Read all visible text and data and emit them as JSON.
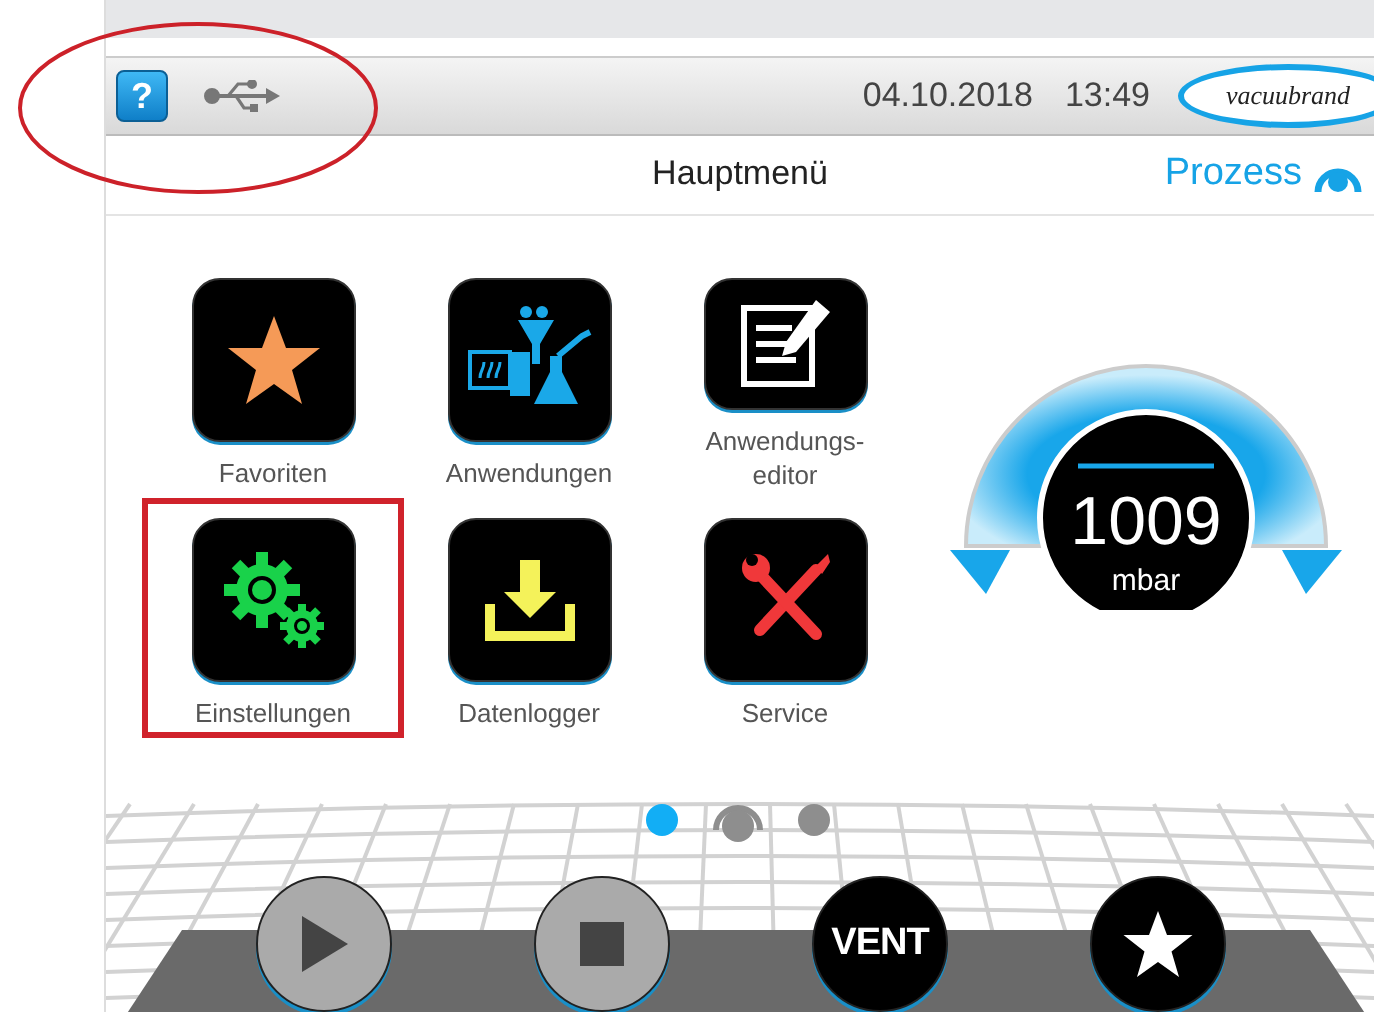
{
  "status_bar": {
    "help_button": "?",
    "date": "04.10.2018",
    "time": "13:49",
    "logo": "vacuubrand",
    "circled": true
  },
  "header": {
    "title": "Hauptmenü",
    "process_link": "Prozess"
  },
  "menu": [
    {
      "kind": "favorites",
      "label": "Favoriten",
      "framed": false
    },
    {
      "kind": "applications",
      "label": "Anwendungen",
      "framed": false
    },
    {
      "kind": "editor",
      "label": "Anwendungs-\neditor",
      "framed": false
    },
    {
      "kind": "settings",
      "label": "Einstellungen",
      "framed": true
    },
    {
      "kind": "datalogger",
      "label": "Datenlogger",
      "framed": false
    },
    {
      "kind": "service",
      "label": "Service",
      "framed": false
    }
  ],
  "gauge": {
    "value": "1009",
    "unit": "mbar"
  },
  "pager": [
    {
      "kind": "dot",
      "selected": true
    },
    {
      "kind": "home",
      "selected": false
    },
    {
      "kind": "dot",
      "selected": false
    }
  ],
  "controls": [
    {
      "kind": "play",
      "disabled": true
    },
    {
      "kind": "stop",
      "disabled": true
    },
    {
      "kind": "text",
      "label": "VENT",
      "disabled": false
    },
    {
      "kind": "star",
      "disabled": false
    }
  ]
}
